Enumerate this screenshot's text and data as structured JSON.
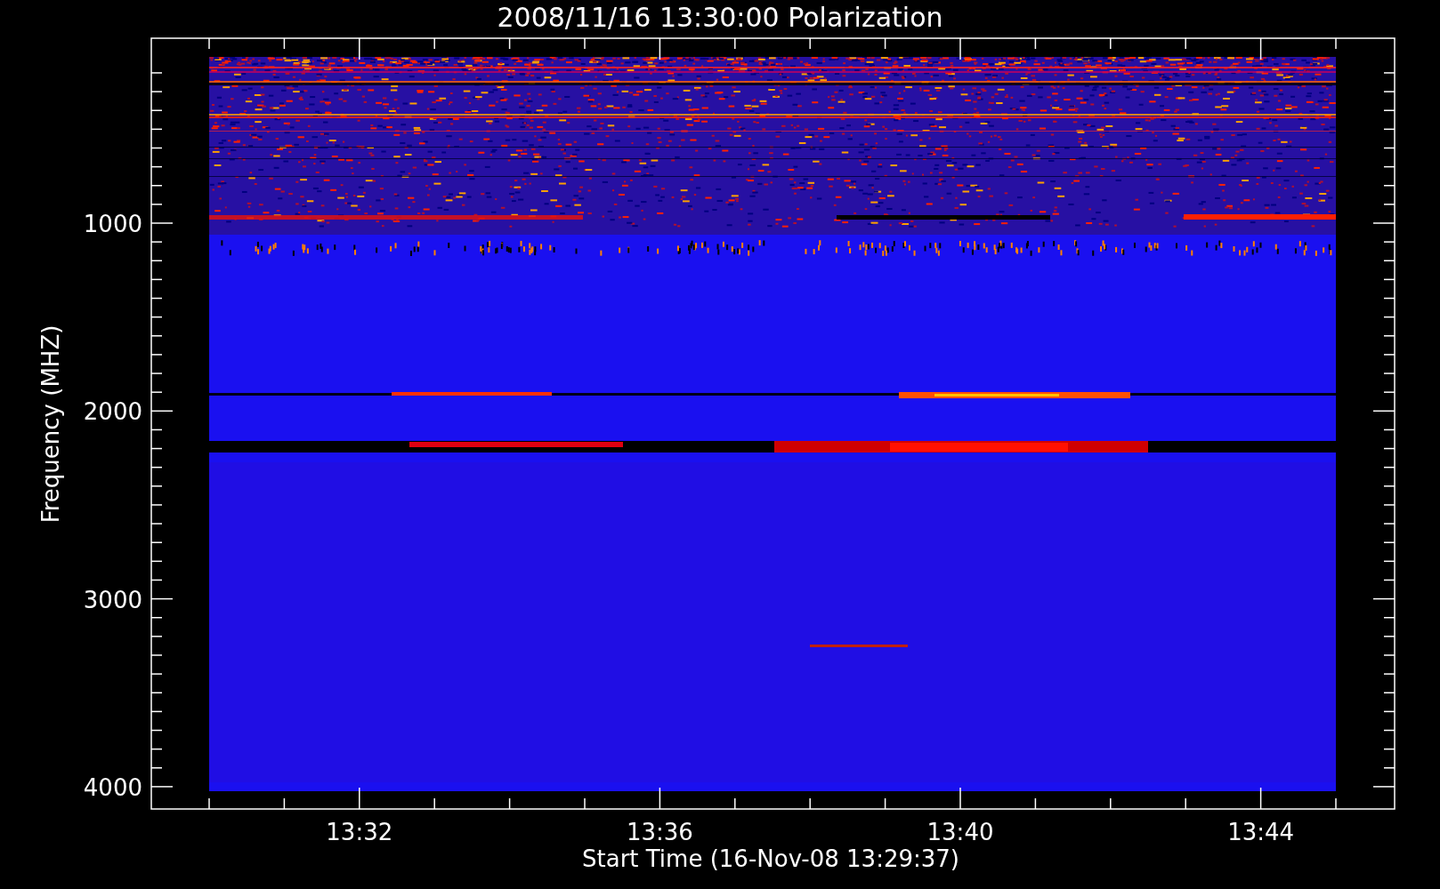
{
  "title": "2008/11/16 13:30:00 Polarization",
  "x_axis": {
    "label": "Start Time (16-Nov-08 13:29:37)",
    "ticks": [
      "13:32",
      "13:36",
      "13:40",
      "13:44"
    ]
  },
  "y_axis": {
    "label": "Frequency (MHZ)",
    "ticks": [
      "1000",
      "2000",
      "3000",
      "4000"
    ]
  }
}
